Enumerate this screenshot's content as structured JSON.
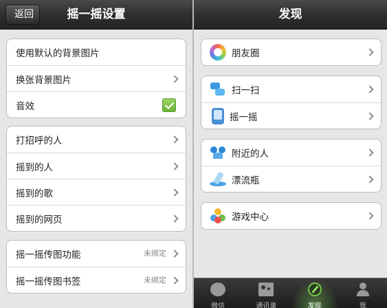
{
  "left": {
    "title": "摇一摇设置",
    "back_label": "返回",
    "groups": [
      [
        {
          "label": "使用默认的背景图片"
        },
        {
          "label": "换张背景图片"
        },
        {
          "label": "音效",
          "checked": true
        }
      ],
      [
        {
          "label": "打招呼的人"
        },
        {
          "label": "摇到的人"
        },
        {
          "label": "摇到的歌"
        },
        {
          "label": "摇到的网页"
        }
      ],
      [
        {
          "label": "摇一摇传图功能",
          "value": "未绑定"
        },
        {
          "label": "摇一摇传图书签",
          "value": "未绑定"
        }
      ]
    ]
  },
  "right": {
    "title": "发现",
    "groups": [
      [
        {
          "label": "朋友圈",
          "icon": "moments-icon"
        }
      ],
      [
        {
          "label": "扫一扫",
          "icon": "scan-icon"
        },
        {
          "label": "摇一摇",
          "icon": "shake-icon"
        }
      ],
      [
        {
          "label": "附近的人",
          "icon": "nearby-people-icon"
        },
        {
          "label": "漂流瓶",
          "icon": "drift-bottle-icon"
        }
      ],
      [
        {
          "label": "游戏中心",
          "icon": "game-center-icon"
        }
      ]
    ],
    "tabs": [
      {
        "label": "微信",
        "icon": "chat-icon"
      },
      {
        "label": "通讯录",
        "icon": "contacts-icon"
      },
      {
        "label": "发现",
        "icon": "discover-icon",
        "active": true
      },
      {
        "label": "我",
        "icon": "me-icon"
      }
    ]
  },
  "colors": {
    "checkbox": "#7cc243",
    "active_tab_glow": "#78c85a",
    "navbar": "#2f2f2f"
  }
}
